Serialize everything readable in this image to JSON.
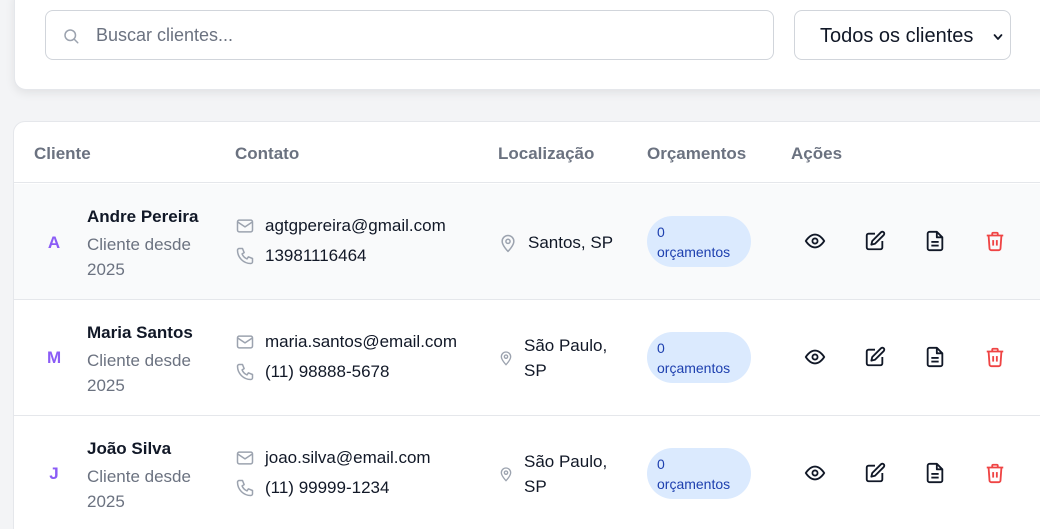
{
  "search": {
    "placeholder": "Buscar clientes..."
  },
  "filter": {
    "selected": "Todos os clientes"
  },
  "table": {
    "headers": {
      "client": "Cliente",
      "contact": "Contato",
      "location": "Localização",
      "quotes": "Orçamentos",
      "actions": "Ações"
    },
    "rows": [
      {
        "initial": "A",
        "name": "Andre Pereira",
        "since": "Cliente desde 2025",
        "email": "agtgpereira@gmail.com",
        "phone": "13981116464",
        "location": "Santos, SP",
        "quotes": "0 orçamentos"
      },
      {
        "initial": "M",
        "name": "Maria Santos",
        "since": "Cliente desde 2025",
        "email": "maria.santos@email.com",
        "phone": "(11) 98888-5678",
        "location": "São Paulo, SP",
        "quotes": "0 orçamentos"
      },
      {
        "initial": "J",
        "name": "João Silva",
        "since": "Cliente desde 2025",
        "email": "joao.silva@email.com",
        "phone": "(11) 99999-1234",
        "location": "São Paulo, SP",
        "quotes": "0 orçamentos"
      }
    ]
  },
  "colors": {
    "accent_initial": "#8b5cf6",
    "badge_bg": "#dbeafe",
    "badge_text": "#1e40af",
    "delete": "#ef4444"
  },
  "icons": [
    "search-icon",
    "chevron-down-icon",
    "mail-icon",
    "phone-icon",
    "map-pin-icon",
    "eye-icon",
    "edit-icon",
    "document-icon",
    "trash-icon"
  ]
}
